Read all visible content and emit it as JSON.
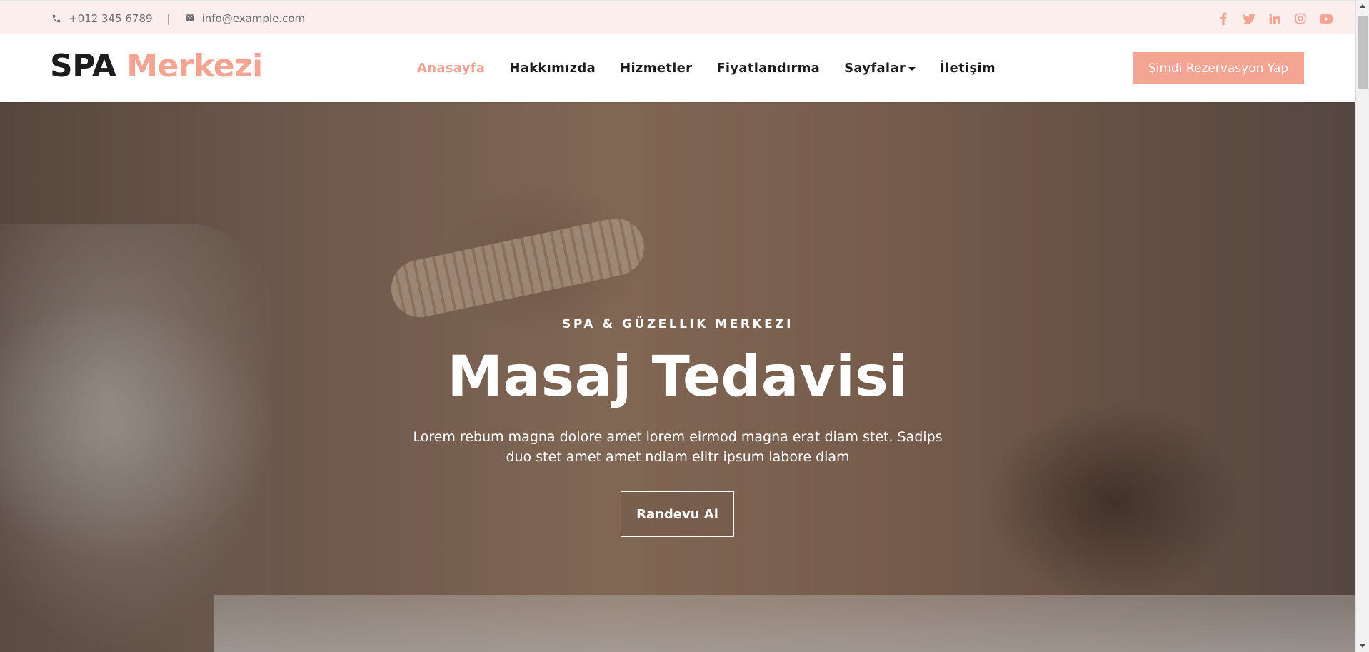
{
  "topbar": {
    "phone": "+012 345 6789",
    "separator": "|",
    "email": "info@example.com",
    "icons": {
      "phone": "phone-icon",
      "email": "envelope-icon"
    },
    "social": [
      "facebook-icon",
      "twitter-icon",
      "linkedin-icon",
      "instagram-icon",
      "youtube-icon"
    ],
    "accent": "#f4a492"
  },
  "brand": {
    "part1": "SPA",
    "part2": "Merkezi"
  },
  "nav": {
    "items": [
      {
        "label": "Anasayfa",
        "active": true
      },
      {
        "label": "Hakkımızda"
      },
      {
        "label": "Hizmetler"
      },
      {
        "label": "Fiyatlandırma"
      },
      {
        "label": "Sayfalar",
        "dropdown": true
      },
      {
        "label": "İletişim"
      }
    ],
    "cta": "Şimdi Rezervasyon Yap"
  },
  "hero": {
    "eyebrow": "SPA & GÜZELLIK MERKEZI",
    "title": "Masaj Tedavisi",
    "text": "Lorem rebum magna dolore amet lorem eirmod magna erat diam stet. Sadips duo stet amet amet ndiam elitr ipsum labore diam",
    "button": "Randevu Al"
  },
  "colors": {
    "accent": "#f4a492",
    "topbar_bg": "#fdeeee",
    "text_dark": "#1c1c1c"
  }
}
